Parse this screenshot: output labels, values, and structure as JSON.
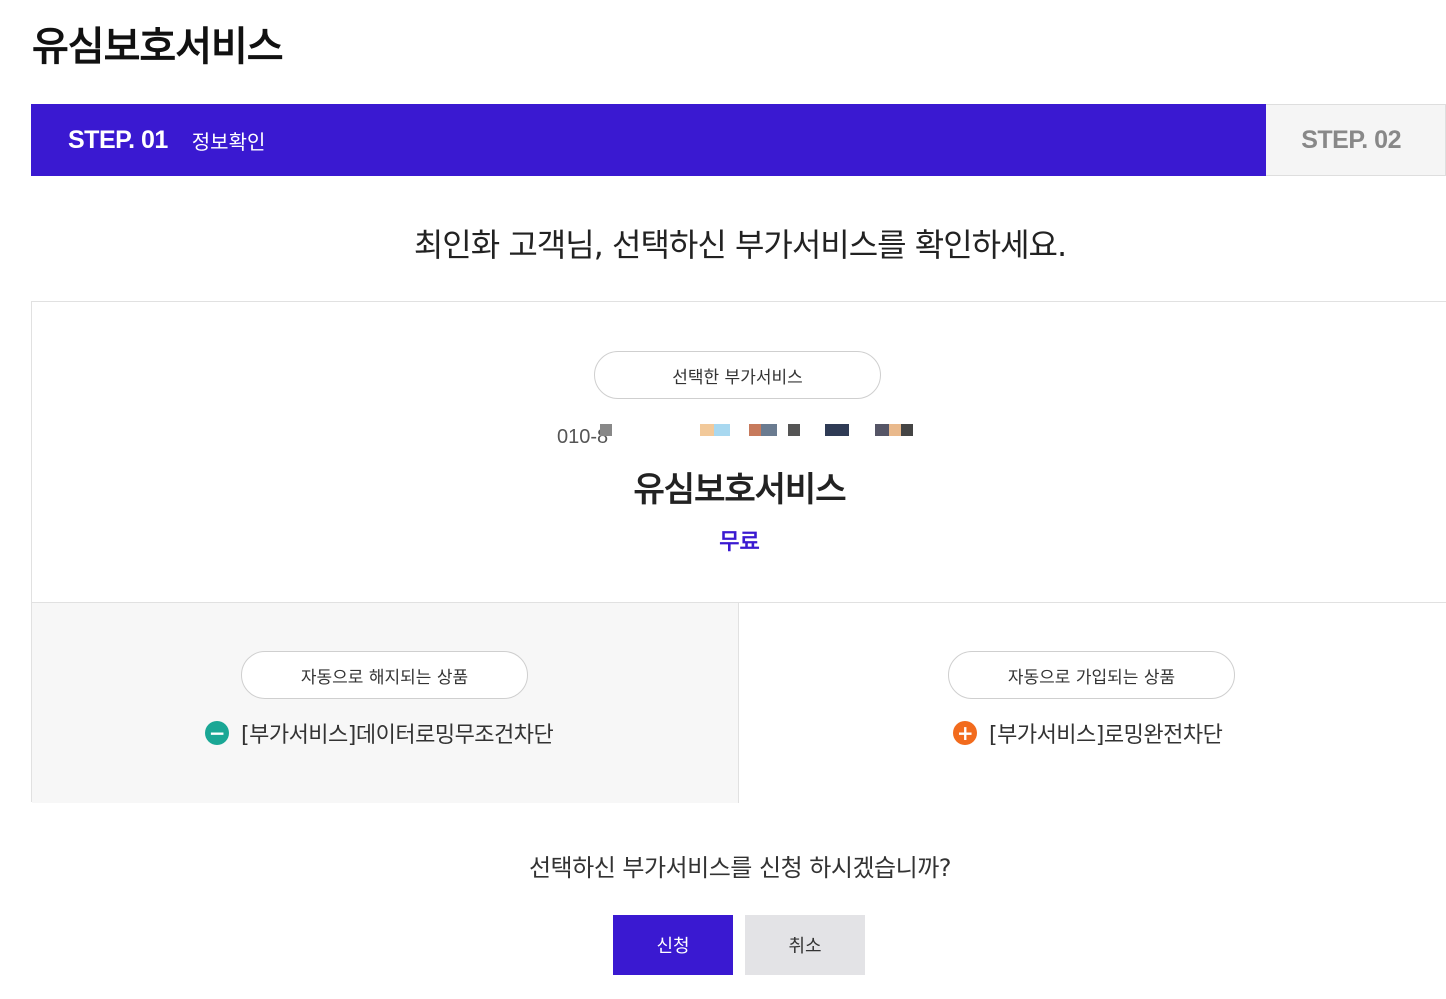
{
  "page": {
    "title": "유심보호서비스"
  },
  "steps": [
    {
      "label": "STEP. 01",
      "sub": "정보확인",
      "active": true
    },
    {
      "label": "STEP. 02",
      "active": false
    }
  ],
  "greeting": "최인화 고객님, 선택하신 부가서비스를 확인하세요.",
  "selected": {
    "pill_label": "선택한 부가서비스",
    "phone_partial": "010-8",
    "service_name": "유심보호서비스",
    "price": "무료"
  },
  "auto_cancel": {
    "pill_label": "자동으로 해지되는 상품",
    "item": "[부가서비스]데이터로밍무조건차단",
    "icon": "minus-circle-icon"
  },
  "auto_join": {
    "pill_label": "자동으로 가입되는 상품",
    "item": "[부가서비스]로밍완전차단",
    "icon": "plus-circle-icon"
  },
  "confirm": {
    "question": "선택하신 부가서비스를 신청 하시겠습니까?",
    "apply_label": "신청",
    "cancel_label": "취소"
  },
  "colors": {
    "brand": "#3a19d1",
    "minus": "#1aa795",
    "plus": "#f26b1d"
  }
}
